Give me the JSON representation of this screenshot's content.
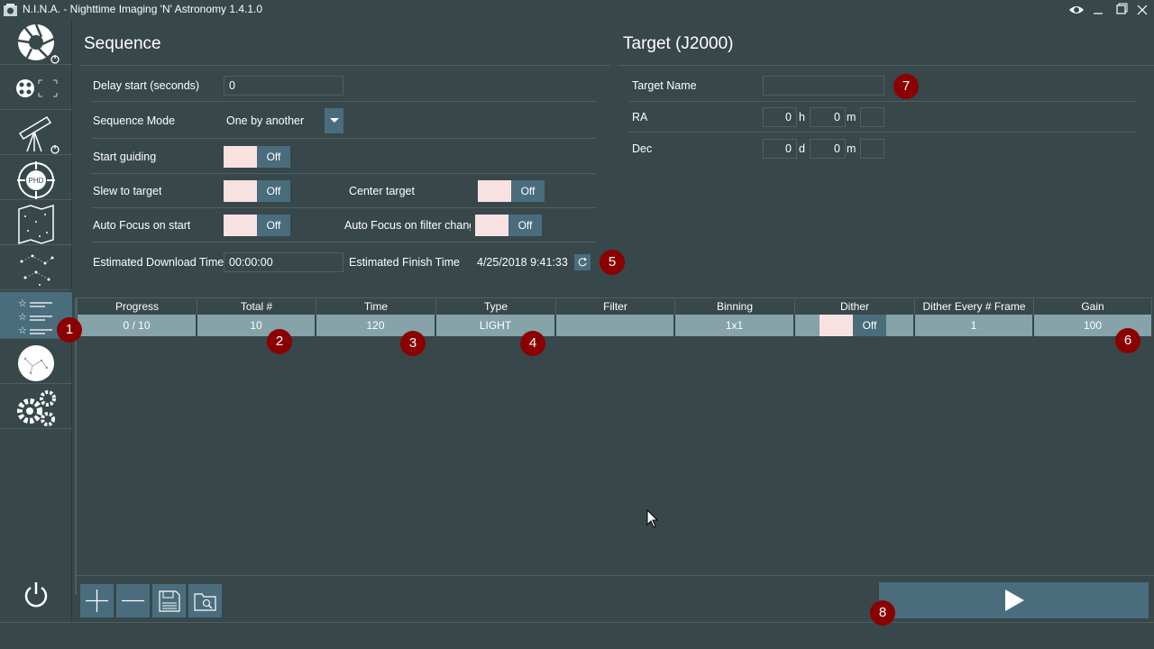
{
  "window": {
    "title": "N.I.N.A. - Nighttime Imaging 'N' Astronomy 1.4.1.0"
  },
  "sidebar": {
    "items": [
      {
        "name": "camera"
      },
      {
        "name": "filter-wheel-focuser"
      },
      {
        "name": "telescope"
      },
      {
        "name": "guider",
        "label": "PHD"
      },
      {
        "name": "sky-atlas"
      },
      {
        "name": "framing"
      },
      {
        "name": "sequence",
        "active": true
      },
      {
        "name": "imaging"
      },
      {
        "name": "options"
      }
    ]
  },
  "sequence": {
    "title": "Sequence",
    "delay_label": "Delay start (seconds)",
    "delay_value": "0",
    "mode_label": "Sequence Mode",
    "mode_value": "One by another",
    "start_guiding_label": "Start guiding",
    "slew_label": "Slew to target",
    "center_label": "Center target",
    "af_start_label": "Auto Focus on start",
    "af_filter_label": "Auto Focus on filter chang",
    "est_download_label": "Estimated Download Time",
    "est_download_value": "00:00:00",
    "est_finish_label": "Estimated Finish Time",
    "est_finish_value": "4/25/2018 9:41:33 I",
    "toggle_off": "Off"
  },
  "target": {
    "title": "Target (J2000)",
    "name_label": "Target Name",
    "name_value": "",
    "ra_label": "RA",
    "ra_h": "0",
    "ra_h_unit": "h",
    "ra_m": "0",
    "ra_m_unit": "m",
    "dec_label": "Dec",
    "dec_d": "0",
    "dec_d_unit": "d",
    "dec_m": "0",
    "dec_m_unit": "m"
  },
  "grid": {
    "headers": [
      "Progress",
      "Total #",
      "Time",
      "Type",
      "Filter",
      "Binning",
      "Dither",
      "Dither Every # Frame",
      "Gain"
    ],
    "row": {
      "progress": "0 / 10",
      "total": "10",
      "time": "120",
      "type": "LIGHT",
      "filter": "",
      "binning": "1x1",
      "dither": "Off",
      "dither_every": "1",
      "gain": "100"
    }
  },
  "badges": [
    "1",
    "2",
    "3",
    "4",
    "5",
    "6",
    "7",
    "8"
  ],
  "colors": {
    "background": "#37474a",
    "accent": "#4a6d7d",
    "row": "#85a3a8",
    "badge": "#8b0000",
    "toggle_knob": "#f7e2e1"
  }
}
